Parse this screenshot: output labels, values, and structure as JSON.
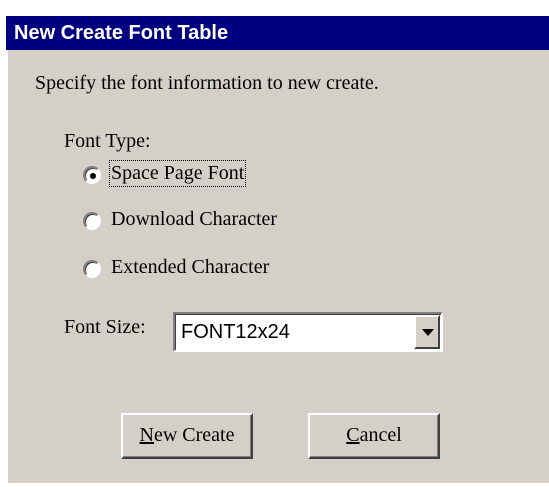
{
  "dialog": {
    "title": "New Create Font Table",
    "instruction": "Specify the font information to new create."
  },
  "font_type": {
    "label": "Font Type:",
    "options": [
      {
        "label": "Space Page Font",
        "selected": true
      },
      {
        "label": "Download Character",
        "selected": false
      },
      {
        "label": "Extended Character",
        "selected": false
      }
    ]
  },
  "font_size": {
    "label": "Font Size:",
    "value": "FONT12x24"
  },
  "buttons": {
    "new_create": {
      "mnemonic": "N",
      "rest": "ew Create"
    },
    "cancel": {
      "mnemonic": "C",
      "rest": "ancel"
    }
  },
  "colors": {
    "titlebar": "#000080",
    "face": "#d4d0c8"
  }
}
